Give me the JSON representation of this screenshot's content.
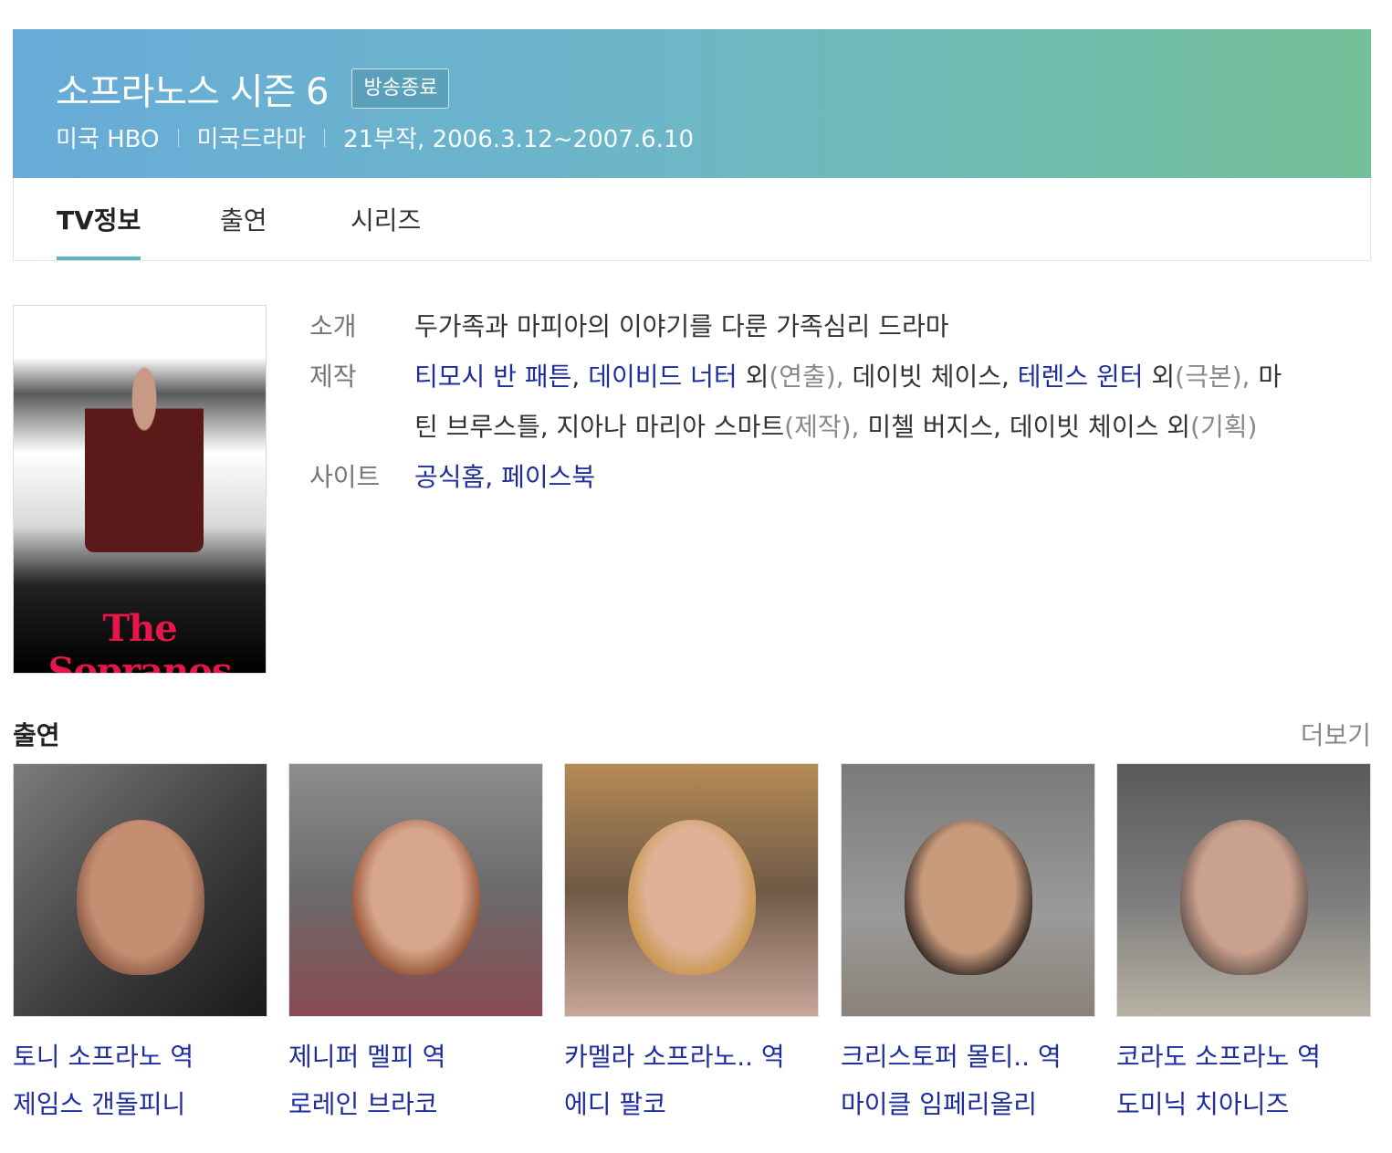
{
  "header": {
    "title": "소프라노스 시즌 6",
    "badge": "방송종료",
    "meta": [
      "미국 HBO",
      "미국드라마",
      "21부작, 2006.3.12~2007.6.10"
    ]
  },
  "tabs": [
    {
      "label": "TV정보",
      "active": true
    },
    {
      "label": "출연",
      "active": false
    },
    {
      "label": "시리즈",
      "active": false
    }
  ],
  "poster": {
    "logo_text": "The Sopranos"
  },
  "info": {
    "intro_label": "소개",
    "intro_text": "두가족과 마피아의 이야기를 다룬 가족심리 드라마",
    "production_label": "제작",
    "production": {
      "director_1": "티모시 반 패튼",
      "director_2": "데이비드 너터",
      "director_suffix": "외",
      "director_role": "(연출),",
      "writer_1": "데이빗 체이스,",
      "writer_2": "테렌스 윈터",
      "writer_suffix": "외",
      "writer_role": "(극본),",
      "producer_1": "마틴 브루스틀,",
      "producer_2": "지아나 마리아 스마트",
      "producer_role": "(제작),",
      "planner_1": "미첼 버지스,",
      "planner_2": "데이빗 체이스",
      "planner_suffix": "외",
      "planner_role": "(기획)"
    },
    "site_label": "사이트",
    "site_links": [
      "공식홈,",
      "페이스북"
    ]
  },
  "cast": {
    "title": "출연",
    "more": "더보기",
    "items": [
      {
        "role": "토니 소프라노 역",
        "name": "제임스 갠돌피니"
      },
      {
        "role": "제니퍼 멜피 역",
        "name": "로레인 브라코"
      },
      {
        "role": "카멜라 소프라노.. 역",
        "name": "에디 팔코"
      },
      {
        "role": "크리스토퍼 몰티.. 역",
        "name": "마이클 임페리올리"
      },
      {
        "role": "코라도 소프라노 역",
        "name": "도미닉 치아니즈"
      }
    ]
  }
}
